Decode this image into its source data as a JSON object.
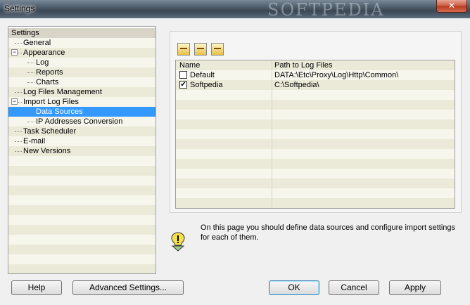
{
  "window": {
    "title": "Settings",
    "watermark": "SOFTPEDIA",
    "close_glyph": "✕"
  },
  "tree": {
    "items": [
      {
        "label": "Settings",
        "level": 0,
        "expander": "",
        "selected": false,
        "header": true
      },
      {
        "label": "General",
        "level": 1,
        "expander": "",
        "selected": false
      },
      {
        "label": "Appearance",
        "level": 1,
        "expander": "−",
        "selected": false
      },
      {
        "label": "Log",
        "level": 2,
        "expander": "",
        "selected": false
      },
      {
        "label": "Reports",
        "level": 2,
        "expander": "",
        "selected": false
      },
      {
        "label": "Charts",
        "level": 2,
        "expander": "",
        "selected": false
      },
      {
        "label": "Log Files Management",
        "level": 1,
        "expander": "",
        "selected": false
      },
      {
        "label": "Import Log Files",
        "level": 1,
        "expander": "−",
        "selected": false
      },
      {
        "label": "Data Sources",
        "level": 2,
        "expander": "",
        "selected": true
      },
      {
        "label": "IP Addresses Conversion",
        "level": 2,
        "expander": "",
        "selected": false
      },
      {
        "label": "Task Scheduler",
        "level": 1,
        "expander": "",
        "selected": false
      },
      {
        "label": "E-mail",
        "level": 1,
        "expander": "",
        "selected": false
      },
      {
        "label": "New Versions",
        "level": 1,
        "expander": "",
        "selected": false
      }
    ]
  },
  "toolbar": {
    "icons": [
      "add-source-icon",
      "edit-source-icon",
      "delete-source-icon"
    ]
  },
  "grid": {
    "columns": [
      "Name",
      "Path to Log Files"
    ],
    "rows": [
      {
        "name": "Default",
        "path": "DATA:\\Etc\\Proxy\\Log\\Http\\Common\\",
        "checked": false
      },
      {
        "name": "Softpedia",
        "path": "C:\\Softpedia\\",
        "checked": true
      }
    ],
    "check_glyph": "✔"
  },
  "info": {
    "text": "On this page you should define data sources and configure import settings for each of them."
  },
  "buttons": {
    "help": "Help",
    "advanced": "Advanced Settings...",
    "ok": "OK",
    "cancel": "Cancel",
    "apply": "Apply"
  }
}
